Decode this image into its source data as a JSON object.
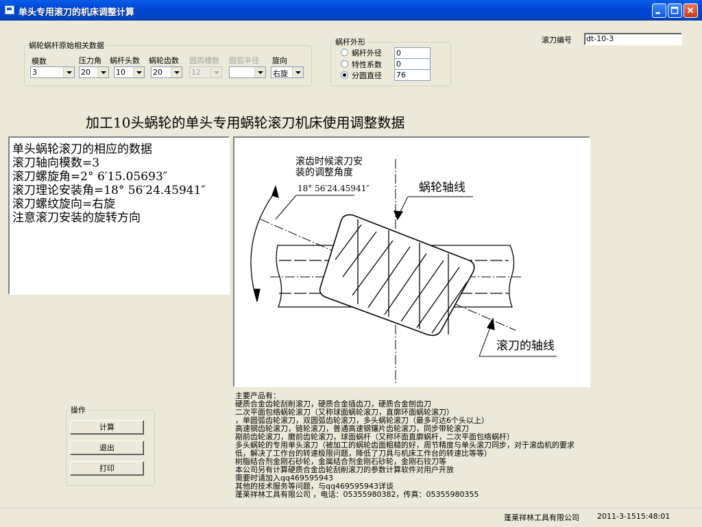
{
  "window": {
    "title": "单头专用滚刀的机床调整计算"
  },
  "params": {
    "legend": "蜗轮蜗杆原始相关数据",
    "fields": [
      {
        "label": "模数",
        "value": "3",
        "disabled": false
      },
      {
        "label": "压力角",
        "value": "20",
        "disabled": false
      },
      {
        "label": "蜗杆头数",
        "value": "10",
        "disabled": false
      },
      {
        "label": "蜗轮齿数",
        "value": "20",
        "disabled": false
      },
      {
        "label": "圆周槽数",
        "value": "12",
        "disabled": true
      },
      {
        "label": "圆弧半径",
        "value": "",
        "disabled": true
      },
      {
        "label": "旋向",
        "value": "右旋",
        "disabled": false
      }
    ]
  },
  "shape": {
    "legend": "蜗杆外形",
    "options": [
      {
        "label": "蜗杆外径",
        "value": "0",
        "selected": false
      },
      {
        "label": "特性系数",
        "value": "0",
        "selected": false
      },
      {
        "label": "分圆直径",
        "value": "76",
        "selected": true
      }
    ]
  },
  "hob_id": {
    "label": "滚刀编号",
    "value": "dt-10-3"
  },
  "heading": "加工10头蜗轮的单头专用蜗轮滚刀机床使用调整数据",
  "results": [
    "单头蜗轮滚刀的相应的数据",
    "滚刀轴向模数=3",
    "滚刀螺旋角=2° 6′15.05693″",
    "滚刀理论安装角=18° 56′24.45941″",
    "滚刀螺纹旋向=右旋",
    "注意滚刀安装的旋转方向"
  ],
  "diagram": {
    "label_install": [
      "滚齿时候滚刀安",
      "装的调整角度"
    ],
    "angle": "18° 56′24.45941″",
    "worm_axis": "蜗轮轴线",
    "hob_axis": "滚刀的轴线"
  },
  "ops": {
    "legend": "操作",
    "calc": "计算",
    "exit": "退出",
    "print": "打印"
  },
  "info_lines": [
    "主要产品有：",
    "硬质合金齿轮刮削滚刀，硬质合金插齿刀，硬质合金刨齿刀",
    "二次平面包络蜗轮滚刀（又称球面蜗轮滚刀，直廓环面蜗轮滚刀）",
    "，单圆弧齿轮滚刀，双圆弧齿轮滚刀，多头蜗轮滚刀（最多可达6个头以上）",
    "高速钢齿轮滚刀，链轮滚刀，普通高速钢镶片齿轮滚刀，同步带轮滚刀",
    "剐前齿轮滚刀，磨前齿轮滚刀，球面蜗杆（又称环面直廓蜗杆，二次平面包络蜗杆）",
    "多头蜗轮的专用单头滚刀（被加工的蜗轮齿面粗糙的好，周节精度与单头滚刀同步，对于滚齿机的要求",
    "低，解决了工作台的转速极限问题，降低了刀具与机床工作台的转速比等等）",
    "树脂结合剂金刚石砂轮，金属结合剂金刚石砂轮，金刚石铰刀等",
    "本公司另有计算硬质合金齿轮刮削滚刀的参数计算软件对用户开放",
    "需要时请加入qq469595943",
    "其他的技术服务等问题，与qq469595943详谈",
    "蓬莱祥林工具有限公司 ，电话：05355980382，传真：05355980355"
  ],
  "status": {
    "company": "蓬莱祥林工具有限公司",
    "datetime": "2011-3-1515:48:01"
  }
}
